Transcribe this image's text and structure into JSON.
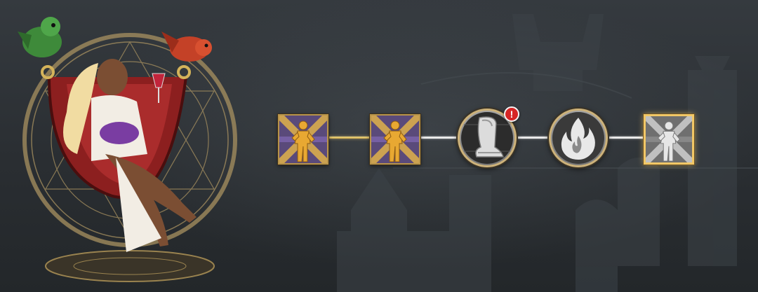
{
  "skill_path": {
    "nodes": [
      {
        "id": "node-1",
        "kind": "square",
        "icon": "hero-pose-icon",
        "state": "unlocked"
      },
      {
        "id": "node-2",
        "kind": "square",
        "icon": "hero-pose-icon",
        "state": "unlocked"
      },
      {
        "id": "node-3",
        "kind": "circle",
        "icon": "armor-boot-icon",
        "state": "locked",
        "alert": true
      },
      {
        "id": "node-4",
        "kind": "circle",
        "icon": "flame-icon",
        "state": "locked"
      },
      {
        "id": "node-5",
        "kind": "square",
        "icon": "hero-pose-icon",
        "state": "locked",
        "selected": true
      }
    ],
    "connectors": [
      "gold",
      "white",
      "white",
      "white"
    ],
    "alert_symbol": "!"
  },
  "colors": {
    "gold": "#f1c766",
    "alert": "#d62525",
    "background": "#2b2f33"
  }
}
